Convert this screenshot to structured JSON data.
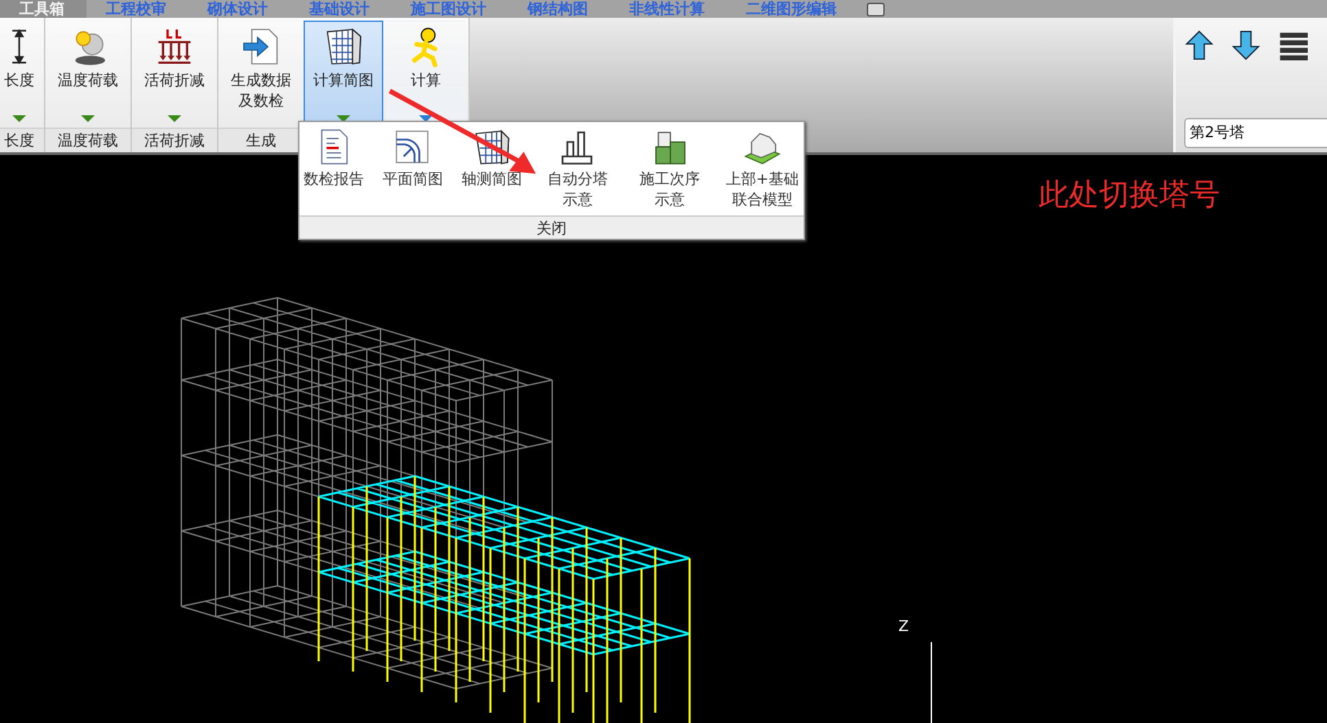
{
  "tabs": [
    {
      "label": "工具箱",
      "selected": true
    },
    {
      "label": "工程校审",
      "selected": false
    },
    {
      "label": "砌体设计",
      "selected": false
    },
    {
      "label": "基础设计",
      "selected": false
    },
    {
      "label": "施工图设计",
      "selected": false
    },
    {
      "label": "钢结构图",
      "selected": false
    },
    {
      "label": "非线性计算",
      "selected": false
    },
    {
      "label": "二维图形编辑",
      "selected": false
    }
  ],
  "ribbon": {
    "groups": [
      {
        "label": "长度",
        "buttons": [
          {
            "kind": "length",
            "label": "长度",
            "selected": false,
            "has_menu": true,
            "hovered": false
          }
        ]
      },
      {
        "label": "温度荷载",
        "buttons": [
          {
            "kind": "temperature",
            "label": "温度荷载",
            "selected": false,
            "has_menu": true,
            "hovered": false
          }
        ]
      },
      {
        "label": "活荷折减",
        "buttons": [
          {
            "kind": "live-load",
            "label": "活荷折减",
            "selected": false,
            "has_menu": true,
            "hovered": false
          }
        ]
      },
      {
        "label": "生成",
        "buttons": [
          {
            "kind": "generate",
            "label": "生成数据及数检",
            "selected": false,
            "has_menu": false,
            "hovered": false
          },
          {
            "kind": "diagram",
            "label": "计算简图",
            "selected": true,
            "has_menu": true,
            "hovered": false
          },
          {
            "kind": "run",
            "label": "计算",
            "selected": false,
            "has_menu": true,
            "hovered": true
          }
        ]
      }
    ]
  },
  "tower_panel": {
    "tower_select": {
      "value": "第2号塔"
    }
  },
  "popup_menu": {
    "items": [
      {
        "kind": "report",
        "label": "数检报告"
      },
      {
        "kind": "plan",
        "label": "平面简图"
      },
      {
        "kind": "axonometric",
        "label": "轴测简图"
      },
      {
        "kind": "tower",
        "label": "自动分塔示意"
      },
      {
        "kind": "sequence",
        "label": "施工次序示意"
      },
      {
        "kind": "foundation",
        "label": "上部+基础联合模型"
      }
    ],
    "close_label": "关闭"
  },
  "annotation": {
    "text": "此处切换塔号"
  },
  "axis": {
    "label": "Z"
  }
}
